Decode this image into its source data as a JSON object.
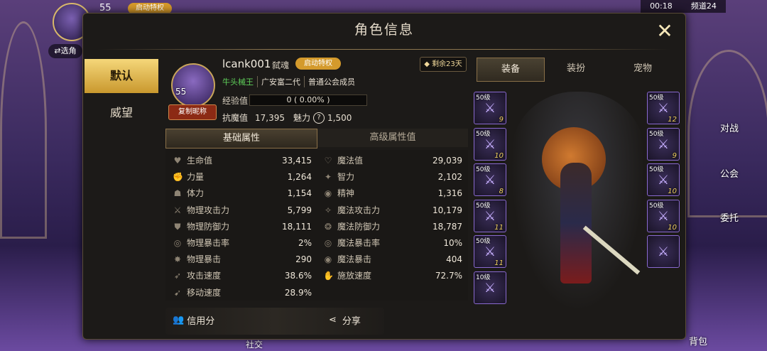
{
  "hud": {
    "level": "55",
    "badge": "启动特权",
    "select_role": "⇄选角",
    "status_time": "00:18",
    "status_channel": "频道24"
  },
  "side_menu": [
    "对战",
    "公会",
    "委托",
    "背包"
  ],
  "bottom_hint": "社交",
  "modal": {
    "title": "角色信息",
    "left_tabs": [
      "默认",
      "威望"
    ],
    "active_left_tab": 0
  },
  "profile": {
    "level": "55",
    "copy_button": "复制昵称",
    "name": "lcank001",
    "class": "弑魂",
    "privilege_badge": "启动特权",
    "remaining": "剩余23天",
    "tags": [
      "牛头械王",
      "广安富二代",
      "普通公会成员"
    ],
    "exp_label": "经验值",
    "exp_text": "0 ( 0.00% )",
    "exp_fraction": 0,
    "resist_label": "抗魔值",
    "resist_value": "17,395",
    "charm_label": "魅力",
    "charm_value": "1,500"
  },
  "attr_tabs": [
    "基础属性",
    "高级属性值"
  ],
  "stats_left": [
    {
      "icon": "heart-icon",
      "glyph": "♥",
      "label": "生命值",
      "value": "33,415"
    },
    {
      "icon": "fist-icon",
      "glyph": "✊",
      "label": "力量",
      "value": "1,264"
    },
    {
      "icon": "body-icon",
      "glyph": "☗",
      "label": "体力",
      "value": "1,154"
    },
    {
      "icon": "sword-icon",
      "glyph": "⚔",
      "label": "物理攻击力",
      "value": "5,799"
    },
    {
      "icon": "shield-icon",
      "glyph": "⛊",
      "label": "物理防御力",
      "value": "18,111"
    },
    {
      "icon": "crit-rate-icon",
      "glyph": "◎",
      "label": "物理暴击率",
      "value": "2%"
    },
    {
      "icon": "crit-icon",
      "glyph": "✸",
      "label": "物理暴击",
      "value": "290"
    },
    {
      "icon": "attack-speed-icon",
      "glyph": "➶",
      "label": "攻击速度",
      "value": "38.6%"
    },
    {
      "icon": "move-speed-icon",
      "glyph": "➹",
      "label": "移动速度",
      "value": "28.9%"
    }
  ],
  "stats_right": [
    {
      "icon": "magic-heart-icon",
      "glyph": "♡",
      "label": "魔法值",
      "value": "29,039"
    },
    {
      "icon": "intellect-icon",
      "glyph": "✦",
      "label": "智力",
      "value": "2,102"
    },
    {
      "icon": "spirit-icon",
      "glyph": "◉",
      "label": "精神",
      "value": "1,316"
    },
    {
      "icon": "magic-attack-icon",
      "glyph": "✧",
      "label": "魔法攻击力",
      "value": "10,179"
    },
    {
      "icon": "magic-defense-icon",
      "glyph": "❂",
      "label": "魔法防御力",
      "value": "18,787"
    },
    {
      "icon": "magic-crit-rate-icon",
      "glyph": "◎",
      "label": "魔法暴击率",
      "value": "10%"
    },
    {
      "icon": "magic-crit-icon",
      "glyph": "◉",
      "label": "魔法暴击",
      "value": "404"
    },
    {
      "icon": "cast-speed-icon",
      "glyph": "✋",
      "label": "施放速度",
      "value": "72.7%"
    }
  ],
  "bottom": {
    "credit": "信用分",
    "share": "分享"
  },
  "equip_tabs": [
    "装备",
    "装扮",
    "宠物"
  ],
  "equip_left": [
    {
      "lv": "50级",
      "st": "9"
    },
    {
      "lv": "50级",
      "st": "10"
    },
    {
      "lv": "50级",
      "st": "8"
    },
    {
      "lv": "50级",
      "st": "11"
    },
    {
      "lv": "50级",
      "st": "11"
    },
    {
      "lv": "10级",
      "st": ""
    }
  ],
  "equip_right": [
    {
      "lv": "50级",
      "st": "12"
    },
    {
      "lv": "50级",
      "st": "9"
    },
    {
      "lv": "50级",
      "st": "10"
    },
    {
      "lv": "50级",
      "st": "10"
    },
    {
      "lv": "",
      "st": ""
    }
  ],
  "colors": {
    "accent": "#e1b955",
    "panel": "#1c1a18",
    "purple_border": "#8a6ad0"
  }
}
